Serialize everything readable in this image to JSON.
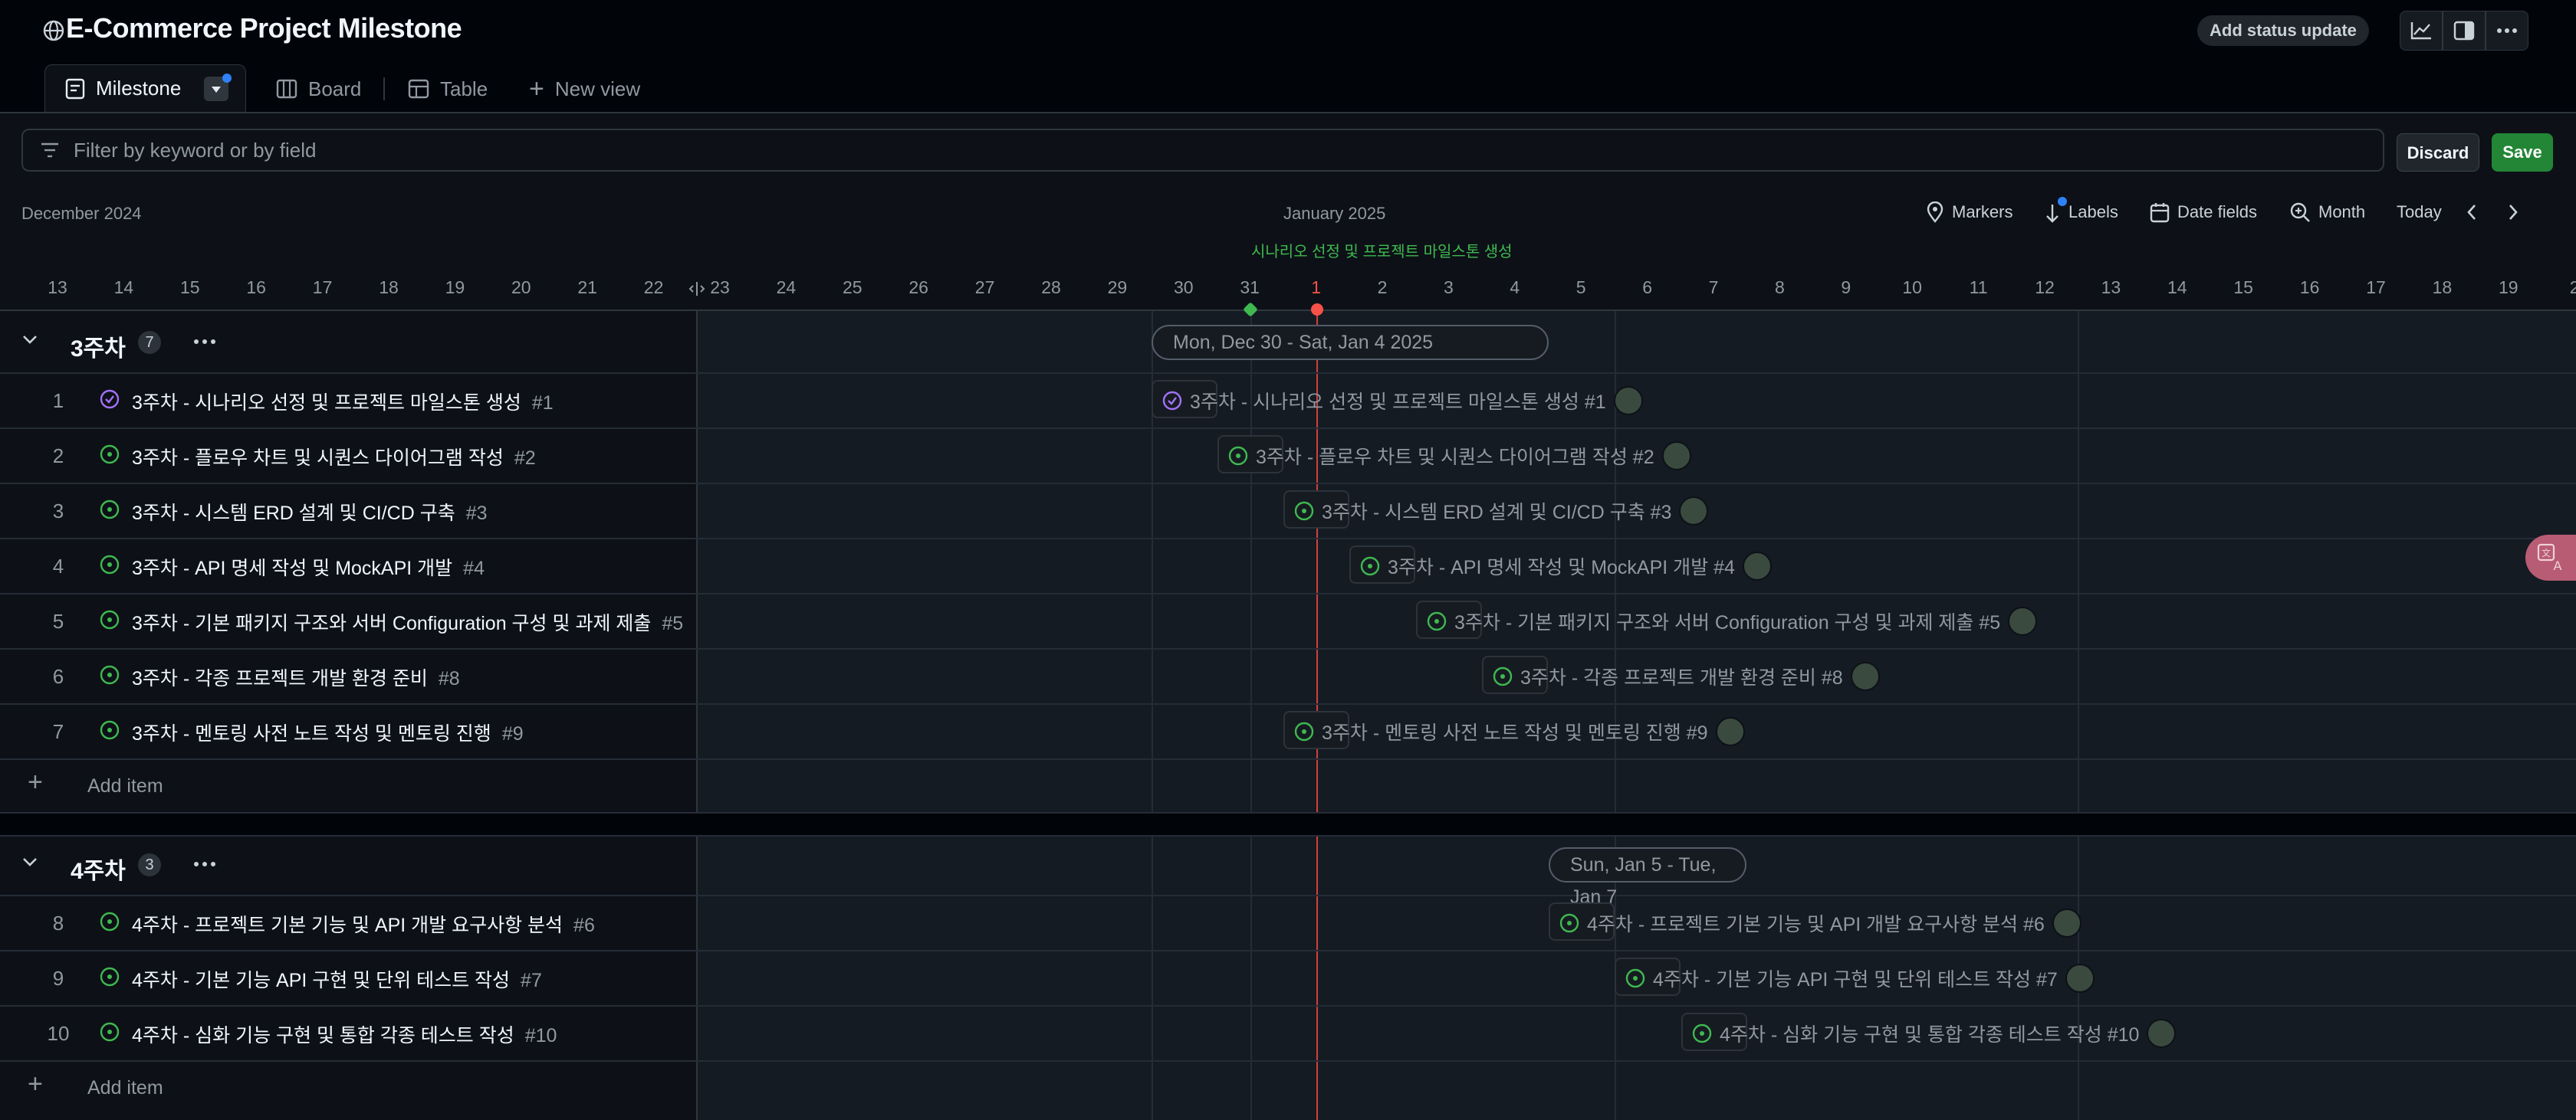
{
  "project": {
    "title": "E-Commerce Project Milestone",
    "status_update": "Add status update"
  },
  "tabs": [
    {
      "label": "Milestone"
    },
    {
      "label": "Board"
    },
    {
      "label": "Table"
    },
    {
      "label": "New view"
    }
  ],
  "filter": {
    "placeholder": "Filter by keyword or by field"
  },
  "actions": {
    "discard": "Discard",
    "save": "Save"
  },
  "timeline": {
    "month_left": "December 2024",
    "month_center": "January 2025",
    "marker_label": "시나리오 선정 및 프로젝트 마일스톤 생성",
    "controls": {
      "markers": "Markers",
      "labels": "Labels",
      "date_fields": "Date fields",
      "zoom": "Month",
      "today": "Today"
    },
    "days": [
      "13",
      "14",
      "15",
      "16",
      "17",
      "18",
      "19",
      "20",
      "21",
      "22",
      "23",
      "24",
      "25",
      "26",
      "27",
      "28",
      "29",
      "30",
      "31",
      "1",
      "2",
      "3",
      "4",
      "5",
      "6",
      "7",
      "8",
      "9",
      "10",
      "11",
      "12",
      "13",
      "14",
      "15",
      "16",
      "17",
      "18",
      "19",
      "2"
    ]
  },
  "groups": [
    {
      "title": "3주차",
      "count": "7",
      "range": "Mon, Dec 30 - Sat, Jan 4 2025",
      "items": [
        {
          "num": "1",
          "title": "3주차 - 시나리오 선정 및 프로젝트 마일스톤 생성",
          "id": "#1",
          "status": "done",
          "bar": "3주차 - 시나리오 선정 및 프로젝트 마일스톤 생성 #1"
        },
        {
          "num": "2",
          "title": "3주차 - 플로우 차트 및 시퀀스 다이어그램 작성",
          "id": "#2",
          "status": "open",
          "bar": "3주차 - 플로우 차트 및 시퀀스 다이어그램 작성 #2"
        },
        {
          "num": "3",
          "title": "3주차 - 시스템 ERD 설계 및 CI/CD 구축",
          "id": "#3",
          "status": "open",
          "bar": "3주차 - 시스템 ERD 설계 및 CI/CD 구축 #3"
        },
        {
          "num": "4",
          "title": "3주차 - API 명세 작성 및 MockAPI 개발",
          "id": "#4",
          "status": "open",
          "bar": "3주차 - API 명세 작성 및 MockAPI 개발 #4"
        },
        {
          "num": "5",
          "title": "3주차 - 기본 패키지 구조와 서버 Configuration 구성 및 과제 제출",
          "id": "#5",
          "status": "open",
          "bar": "3주차 - 기본 패키지 구조와 서버 Configuration 구성 및 과제 제출 #5"
        },
        {
          "num": "6",
          "title": "3주차 - 각종 프로젝트 개발 환경 준비",
          "id": "#8",
          "status": "open",
          "bar": "3주차 - 각종 프로젝트 개발 환경 준비 #8"
        },
        {
          "num": "7",
          "title": "3주차 - 멘토링 사전 노트 작성 및 멘토링 진행",
          "id": "#9",
          "status": "open",
          "bar": "3주차 - 멘토링 사전 노트 작성 및 멘토링 진행 #9"
        }
      ],
      "add_item": "Add item"
    },
    {
      "title": "4주차",
      "count": "3",
      "range": "Sun, Jan 5 - Tue, Jan 7",
      "items": [
        {
          "num": "8",
          "title": "4주차 - 프로젝트 기본 기능 및 API 개발 요구사항 분석",
          "id": "#6",
          "status": "open",
          "bar": "4주차 - 프로젝트 기본 기능 및 API 개발 요구사항 분석 #6"
        },
        {
          "num": "9",
          "title": "4주차 - 기본 기능 API 구현 및 단위 테스트 작성",
          "id": "#7",
          "status": "open",
          "bar": "4주차 - 기본 기능 API 구현 및 단위 테스트 작성 #7"
        },
        {
          "num": "10",
          "title": "4주차 - 심화 기능 구현 및 통합 각종 테스트 작성",
          "id": "#10",
          "status": "open",
          "bar": "4주차 - 심화 기능 구현 및 통합 각종 테스트 작성 #10"
        }
      ],
      "add_item": "Add item"
    }
  ],
  "colors": {
    "open": "#3fb950",
    "done": "#a371f7",
    "today": "#f85149",
    "accent": "#238636"
  }
}
